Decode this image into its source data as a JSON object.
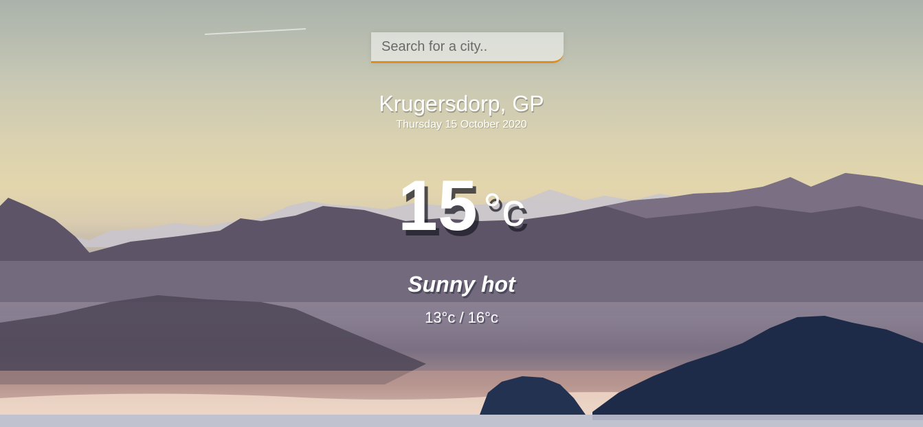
{
  "search": {
    "placeholder": "Search for a city..",
    "value": ""
  },
  "location": {
    "city": "Krugersdorp, GP",
    "date": "Thursday 15 October 2020"
  },
  "weather": {
    "temperature": "15",
    "degree_symbol": "°",
    "unit": "c",
    "condition": "Sunny hot",
    "hi_low": "13°c / 16°c"
  },
  "colors": {
    "accent": "#df8e1d",
    "text": "#ffffff"
  }
}
